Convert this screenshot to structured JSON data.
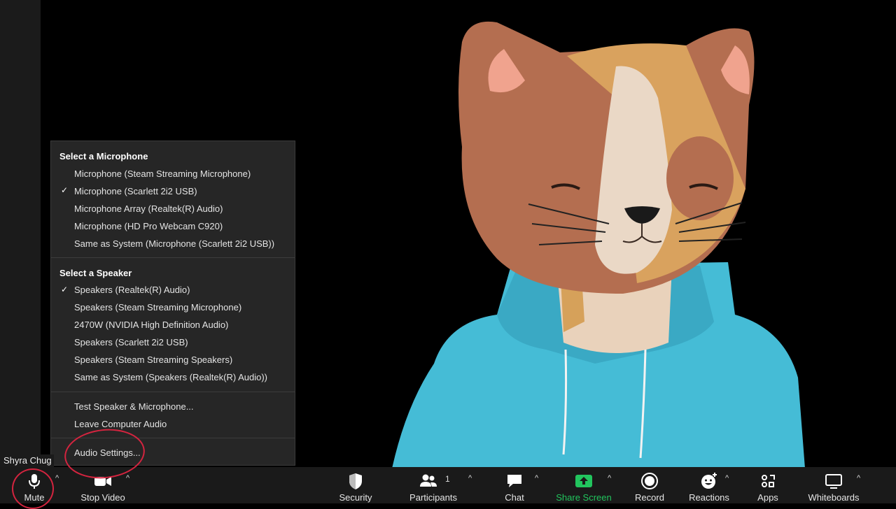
{
  "participant": {
    "name": "Shyra Chug"
  },
  "audio_menu": {
    "mic_heading": "Select a Microphone",
    "microphones": [
      {
        "label": "Microphone (Steam Streaming Microphone)",
        "selected": false
      },
      {
        "label": "Microphone (Scarlett 2i2 USB)",
        "selected": true
      },
      {
        "label": "Microphone Array (Realtek(R) Audio)",
        "selected": false
      },
      {
        "label": "Microphone (HD Pro Webcam C920)",
        "selected": false
      },
      {
        "label": "Same as System (Microphone (Scarlett 2i2 USB))",
        "selected": false
      }
    ],
    "speaker_heading": "Select a Speaker",
    "speakers": [
      {
        "label": "Speakers (Realtek(R) Audio)",
        "selected": true
      },
      {
        "label": "Speakers (Steam Streaming Microphone)",
        "selected": false
      },
      {
        "label": "2470W (NVIDIA High Definition Audio)",
        "selected": false
      },
      {
        "label": "Speakers (Scarlett 2i2 USB)",
        "selected": false
      },
      {
        "label": "Speakers (Steam Streaming Speakers)",
        "selected": false
      },
      {
        "label": "Same as System (Speakers (Realtek(R) Audio))",
        "selected": false
      }
    ],
    "test_label": "Test Speaker & Microphone...",
    "leave_label": "Leave Computer Audio",
    "settings_label": "Audio Settings...",
    "check_glyph": "✓"
  },
  "toolbar": {
    "mute": "Mute",
    "stop_video": "Stop Video",
    "security": "Security",
    "participants": "Participants",
    "participants_count": "1",
    "chat": "Chat",
    "share_screen": "Share Screen",
    "record": "Record",
    "reactions": "Reactions",
    "apps": "Apps",
    "whiteboards": "Whiteboards",
    "caret": "^"
  },
  "colors": {
    "share_green": "#22c55e",
    "annotation_red": "#d4243f",
    "menu_bg": "#262626"
  }
}
